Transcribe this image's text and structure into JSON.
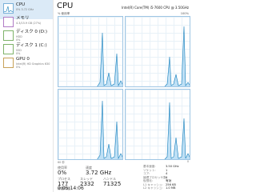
{
  "sidebar": {
    "items": [
      {
        "title": "CPU",
        "sub": "0%  3.72 GHz",
        "sub2": "",
        "selected": true
      },
      {
        "title": "メモリ",
        "sub": "4.3/15.9 GB (27%)",
        "sub2": ""
      },
      {
        "title": "ディスク 0 (D:)",
        "sub": "HDD",
        "sub2": "0%"
      },
      {
        "title": "ディスク 1 (C:)",
        "sub": "SSD",
        "sub2": "0%"
      },
      {
        "title": "GPU 0",
        "sub": "Intel(R) HD Graphics 630",
        "sub2": "0%"
      }
    ]
  },
  "main": {
    "title": "CPU",
    "cpu_name": "Intel(R) Core(TM) i5-7600 CPU @ 3.50GHz",
    "util_label": "% 使用率",
    "pct_label": "100%",
    "time_left": "60 秒",
    "time_right": "0"
  },
  "stats": {
    "utilization_label": "使用率",
    "utilization_value": "0%",
    "speed_label": "速度",
    "speed_value": "3.72 GHz",
    "processes_label": "プロセス",
    "processes_value": "177",
    "threads_label": "スレッド",
    "threads_value": "2332",
    "handles_label": "ハンドル",
    "handles_value": "71325",
    "uptime_label": "稼働時間",
    "uptime_value": "0:05:14:06"
  },
  "details": [
    {
      "label": "基本速度:",
      "value": "3.50 GHz"
    },
    {
      "label": "ソケット:",
      "value": "1"
    },
    {
      "label": "コア:",
      "value": "4"
    },
    {
      "label": "論理プロセッサ数:",
      "value": "4"
    },
    {
      "label": "仮想化:",
      "value": "有効"
    },
    {
      "label": "L1 キャッシュ:",
      "value": "256 KB"
    },
    {
      "label": "L2 キャッシュ:",
      "value": "1.0 MB"
    },
    {
      "label": "L3 キャッシュ:",
      "value": "6.0 MB"
    }
  ],
  "colors": {
    "cpu_line": "#117dbb",
    "cpu_fill": "#bfe0f5",
    "selected_bg": "#dbeaf7"
  }
}
